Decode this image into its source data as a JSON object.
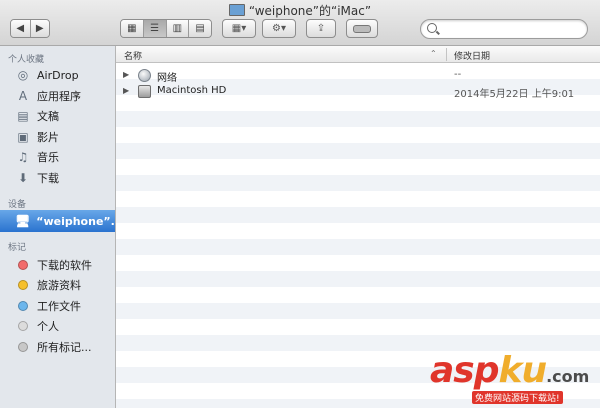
{
  "window": {
    "title": "“weiphone”的“iMac”"
  },
  "toolbar": {
    "nav": [
      "◀",
      "▶"
    ],
    "view_buttons": [
      "grid-view-icon",
      "list-view-icon",
      "column-view-icon",
      "coverflow-view-icon"
    ],
    "arrange_icon": "arrange-icon",
    "action_icon": "gear-icon",
    "share_icon": "share-icon",
    "tags_icon": "tag-icon",
    "search_placeholder": ""
  },
  "sidebar": {
    "favorites_heading": "个人收藏",
    "favorites": [
      {
        "label": "AirDrop",
        "icon": "airdrop-icon"
      },
      {
        "label": "应用程序",
        "icon": "applications-icon"
      },
      {
        "label": "文稿",
        "icon": "documents-icon"
      },
      {
        "label": "影片",
        "icon": "movies-icon"
      },
      {
        "label": "音乐",
        "icon": "music-icon"
      },
      {
        "label": "下载",
        "icon": "downloads-icon"
      }
    ],
    "devices_heading": "设备",
    "devices": [
      {
        "label": "“weiphone”...",
        "icon": "imac-icon",
        "selected": true
      }
    ],
    "tags_heading": "标记",
    "tags": [
      {
        "label": "下载的软件",
        "color": "#f26b6b"
      },
      {
        "label": "旅游资料",
        "color": "#f6c02c"
      },
      {
        "label": "工作文件",
        "color": "#6cb6ec"
      },
      {
        "label": "个人",
        "color": "#dcdcdc"
      },
      {
        "label": "所有标记...",
        "color": "#c8c8c8"
      }
    ]
  },
  "list": {
    "col_name": "名称",
    "col_date": "修改日期",
    "rows": [
      {
        "name": "网络",
        "date": "--",
        "icon": "network-icon"
      },
      {
        "name": "Macintosh HD",
        "date": "2014年5月22日 上午9:01",
        "icon": "hard-disk-icon"
      }
    ]
  },
  "watermark": {
    "brand": "aspku",
    "domain": ".com",
    "tagline": "免费网站源码下载站!"
  }
}
